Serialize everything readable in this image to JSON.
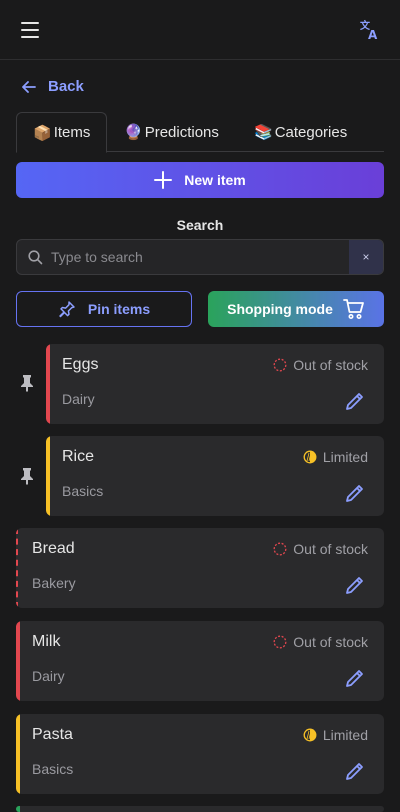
{
  "header": {
    "menu_icon": "hamburger-menu-icon",
    "translate_icon": "translate-icon"
  },
  "nav": {
    "back_label": "Back"
  },
  "tabs": [
    {
      "emoji": "📦",
      "label": "Items",
      "active": true
    },
    {
      "emoji": "🔮",
      "label": "Predictions",
      "active": false
    },
    {
      "emoji": "📚",
      "label": "Categories",
      "active": false
    }
  ],
  "actions": {
    "new_item_label": "New item",
    "pin_items_label": "Pin items",
    "shopping_mode_label": "Shopping mode"
  },
  "search": {
    "label": "Search",
    "placeholder": "Type to search",
    "value": "",
    "clear_label": "×"
  },
  "colors": {
    "out_of_stock": "#e2474f",
    "limited": "#f6c026",
    "accent": "#8c9eff"
  },
  "items": [
    {
      "name": "Eggs",
      "category": "Dairy",
      "status": "Out of stock",
      "pinned": true
    },
    {
      "name": "Rice",
      "category": "Basics",
      "status": "Limited",
      "pinned": true
    },
    {
      "name": "Bread",
      "category": "Bakery",
      "status": "Out of stock",
      "pinned": false
    },
    {
      "name": "Milk",
      "category": "Dairy",
      "status": "Out of stock",
      "pinned": false
    },
    {
      "name": "Pasta",
      "category": "Basics",
      "status": "Limited",
      "pinned": false
    }
  ]
}
